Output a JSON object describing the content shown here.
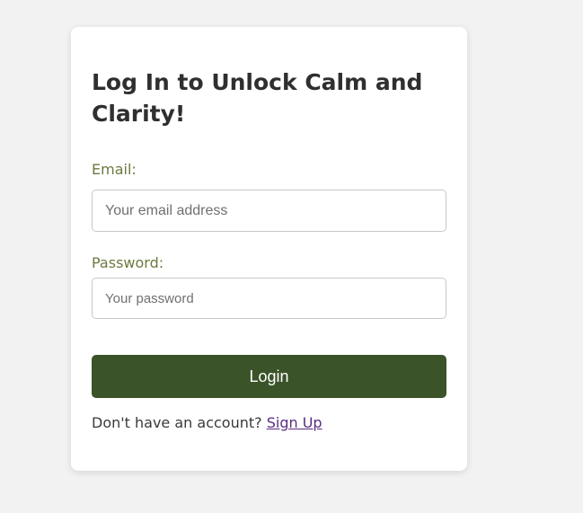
{
  "login_form": {
    "title": "Log In to Unlock Calm and Clarity!",
    "email_label": "Email:",
    "email_placeholder": "Your email address",
    "email_value": "",
    "password_label": "Password:",
    "password_placeholder": "Your password",
    "password_value": "",
    "submit_label": "Login",
    "signup_prompt": "Don't have an account?",
    "signup_link": "Sign Up"
  },
  "colors": {
    "page_background": "#f2f2f2",
    "card_background": "#ffffff",
    "button_background": "#3b5329",
    "label_color": "#6b7a3f",
    "link_color": "#5a2d82"
  }
}
